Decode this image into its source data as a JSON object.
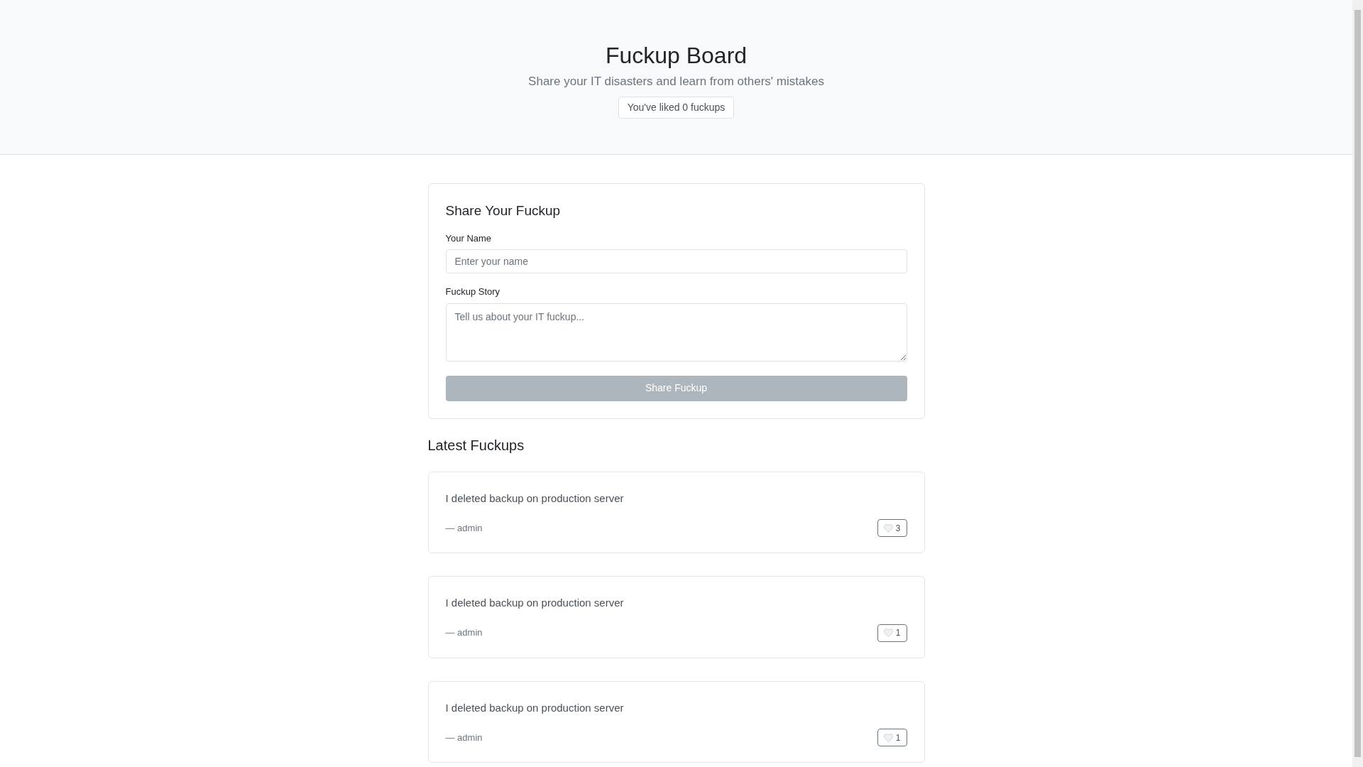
{
  "header": {
    "title": "Fuckup Board",
    "subtitle": "Share your IT disasters and learn from others' mistakes",
    "liked_badge": "You've liked 0 fuckups"
  },
  "form": {
    "title": "Share Your Fuckup",
    "name_label": "Your Name",
    "name_placeholder": "Enter your name",
    "story_label": "Fuckup Story",
    "story_placeholder": "Tell us about your IT fuckup...",
    "submit": {
      "label": "Share Fuckup",
      "disabled": true
    }
  },
  "latest": {
    "title": "Latest Fuckups",
    "posts": [
      {
        "story": "I deleted backup on production server",
        "author": "— admin",
        "likes": "3",
        "liked": false
      },
      {
        "story": "I deleted backup on production server",
        "author": "— admin",
        "likes": "1",
        "liked": false
      },
      {
        "story": "I deleted backup on production server",
        "author": "— admin",
        "likes": "1",
        "liked": false
      }
    ]
  }
}
